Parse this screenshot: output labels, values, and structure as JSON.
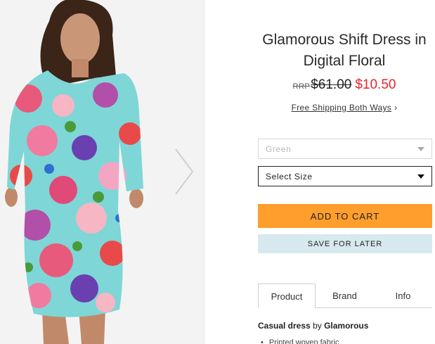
{
  "product": {
    "title": "Glamorous Shift Dress in Digital Floral",
    "image_alt": "Model wearing floral shift dress"
  },
  "pricing": {
    "rrp_label": "RRP",
    "old_price": "$61.00",
    "sale_price": "$10.50",
    "sale_color": "#e8232b"
  },
  "shipping": {
    "link_text": "Free Shipping Both Ways",
    "chevron": "›"
  },
  "options": {
    "colour_value": "Green",
    "size_value": "Select Size"
  },
  "actions": {
    "add_to_cart": "ADD TO CART",
    "save_for_later": "SAVE FOR LATER",
    "cart_color": "#ff9e2c",
    "save_color": "#d7e9ee"
  },
  "tabs": [
    {
      "label": "Product",
      "active": true
    },
    {
      "label": "Brand",
      "active": false
    },
    {
      "label": "Info",
      "active": false
    }
  ],
  "description": {
    "type_text": "Casual dress",
    "by_text": "by",
    "brand_text": "Glamorous",
    "first_bullet": "Printed woven fabric"
  },
  "gallery": {
    "next_icon": "chevron-right-icon"
  }
}
